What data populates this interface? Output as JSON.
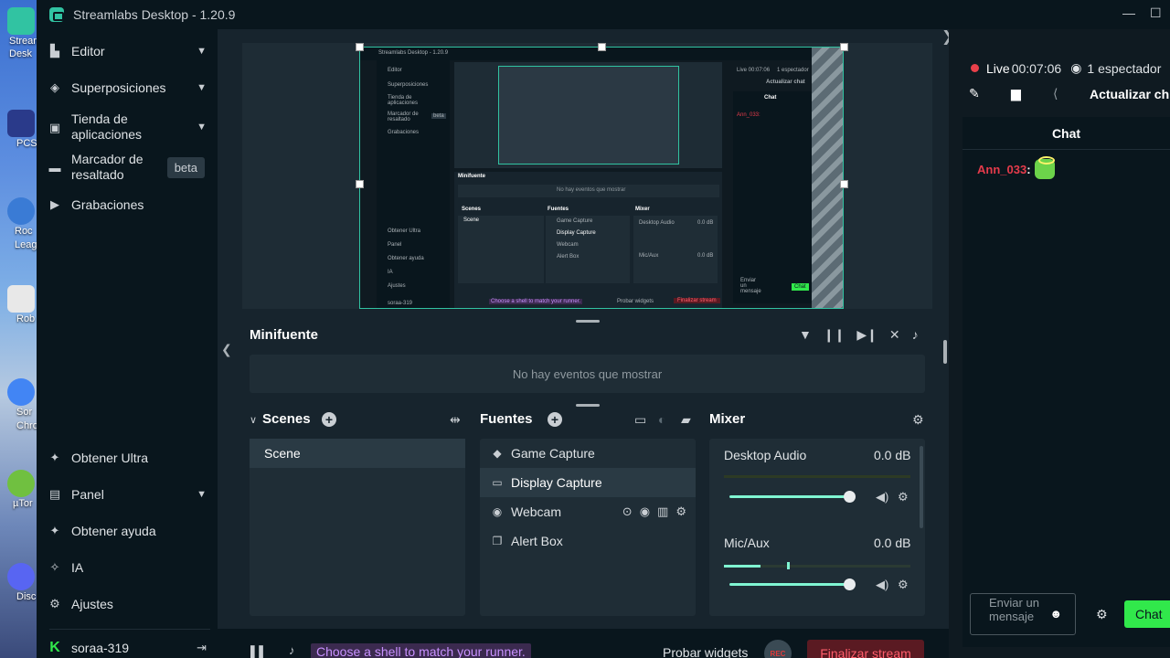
{
  "app": {
    "title": "Streamlabs Desktop - 1.20.9"
  },
  "window_controls": {
    "minimize": "—",
    "maximize": "☐"
  },
  "desktop": {
    "icons": [
      {
        "label": "Stream Desk",
        "color": "#31c3a2"
      },
      {
        "label": "PCS",
        "color": "#2a3a8a"
      },
      {
        "label": "Roc Leag",
        "color": "#3a7bd5"
      },
      {
        "label": "Rob",
        "color": "#e8e8e8"
      },
      {
        "label": "Sor Chro",
        "color": "#4285f4"
      },
      {
        "label": "µTor",
        "color": "#70c040"
      },
      {
        "label": "Disc",
        "color": "#5865f2"
      }
    ]
  },
  "sidebar": {
    "items": [
      {
        "label": "Editor",
        "icon": "editor-icon",
        "has_chevron": true
      },
      {
        "label": "Superposiciones",
        "icon": "overlays-icon",
        "has_chevron": true
      },
      {
        "label": "Tienda de aplicaciones",
        "icon": "app-store-icon",
        "has_chevron": true
      },
      {
        "label": "Marcador de resaltado",
        "icon": "highlighter-icon",
        "badge": "beta"
      },
      {
        "label": "Grabaciones",
        "icon": "recordings-icon"
      }
    ],
    "bottom_items": [
      {
        "label": "Obtener Ultra",
        "icon": "ultra-icon"
      },
      {
        "label": "Panel",
        "icon": "dashboard-icon",
        "has_chevron": true
      },
      {
        "label": "Obtener ayuda",
        "icon": "help-icon"
      },
      {
        "label": "IA",
        "icon": "ai-sparkle-icon"
      },
      {
        "label": "Ajustes",
        "icon": "gear-icon"
      }
    ],
    "user": {
      "name": "soraa-319",
      "logo": "K"
    }
  },
  "minifeed": {
    "title": "Minifuente",
    "empty_text": "No hay eventos que mostrar"
  },
  "scenes": {
    "title": "Scenes",
    "items": [
      "Scene"
    ]
  },
  "sources": {
    "title": "Fuentes",
    "items": [
      {
        "label": "Game Capture",
        "icon": "gamepad-icon"
      },
      {
        "label": "Display Capture",
        "icon": "monitor-icon",
        "selected": true
      },
      {
        "label": "Webcam",
        "icon": "webcam-icon",
        "hovered": true
      },
      {
        "label": "Alert Box",
        "icon": "alert-box-icon"
      }
    ]
  },
  "mixer": {
    "title": "Mixer",
    "channels": [
      {
        "name": "Desktop Audio",
        "db": "0.0 dB",
        "volume": 1.0
      },
      {
        "name": "Mic/Aux",
        "db": "0.0 dB",
        "volume": 1.0
      }
    ]
  },
  "footer": {
    "promo": "Choose a shell to match your runner.",
    "test_widgets": "Probar widgets",
    "rec": "REC",
    "end_stream": "Finalizar stream"
  },
  "stream_info": {
    "live_label": "Live",
    "time": "00:07:06",
    "viewers": "1 espectador",
    "update_label": "Actualizar ch"
  },
  "chat": {
    "title": "Chat",
    "messages": [
      {
        "user": "Ann_033",
        "sep": ":"
      }
    ],
    "input_placeholder": "Enviar un mensaje",
    "send_label": "Chat"
  },
  "mini_preview": {
    "title": "Streamlabs Desktop - 1.20.9",
    "nav": [
      "Editor",
      "Superposiciones",
      "Tienda de aplicaciones",
      "Marcador de resaltado",
      "Grabaciones"
    ],
    "bottom": [
      "Obtener Ultra",
      "Panel",
      "Obtener ayuda",
      "IA",
      "Ajustes",
      "soraa-319"
    ],
    "minifeed": "Minifuente",
    "empty": "No hay eventos que mostrar",
    "scenes": "Scenes",
    "scene": "Scene",
    "sources": "Fuentes",
    "source_items": [
      "Game Capture",
      "Display Capture",
      "Webcam",
      "Alert Box"
    ],
    "mixer": "Mixer",
    "mix1": "Desktop Audio",
    "mix2": "Mic/Aux",
    "db": "0.0 dB",
    "chat": "Chat",
    "live": "Live 00:07:06",
    "viewers": "1 espectador",
    "update": "Actualizar chat",
    "chatter": "Ann_033:",
    "input": "Enviar un mensaje",
    "send": "Chat",
    "promo": "Choose a shell to match your runner.",
    "test": "Probar widgets",
    "end": "Finalizar stream",
    "beta": "beta"
  }
}
